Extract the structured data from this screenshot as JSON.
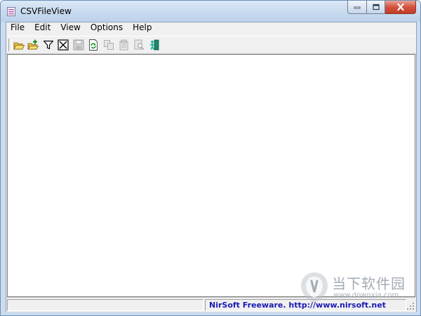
{
  "window": {
    "title": "CSVFileView"
  },
  "menu": {
    "items": [
      {
        "label": "File"
      },
      {
        "label": "Edit"
      },
      {
        "label": "View"
      },
      {
        "label": "Options"
      },
      {
        "label": "Help"
      }
    ]
  },
  "toolbar": {
    "buttons": [
      {
        "icon": "open-folder-icon",
        "enabled": true
      },
      {
        "icon": "open-folder-plus-icon",
        "enabled": true
      },
      {
        "icon": "filter-icon",
        "enabled": true
      },
      {
        "icon": "hourglass-icon",
        "enabled": true
      },
      {
        "icon": "save-icon",
        "enabled": false
      },
      {
        "icon": "refresh-icon",
        "enabled": true
      },
      {
        "icon": "copy-icon",
        "enabled": false
      },
      {
        "icon": "properties-icon",
        "enabled": false
      },
      {
        "icon": "find-icon",
        "enabled": false
      },
      {
        "icon": "exit-icon",
        "enabled": true
      }
    ]
  },
  "statusbar": {
    "left_text": "",
    "link_text": "NirSoft Freeware.  http://www.nirsoft.net"
  },
  "watermark": {
    "brand_cn": "当下软件园",
    "url": "www.downxia.com"
  },
  "colors": {
    "titlebar": "#c9dbef",
    "close_button": "#c94a35",
    "status_link": "#1a1ab5"
  }
}
